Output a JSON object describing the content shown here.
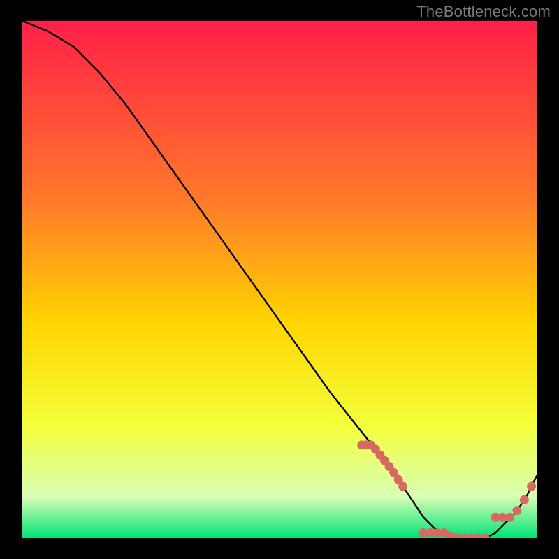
{
  "watermark": "TheBottleneck.com",
  "colors": {
    "gradient_top": "#ff1f48",
    "gradient_mid1": "#ff7a2a",
    "gradient_mid2": "#ffd400",
    "gradient_mid3": "#f4ff3a",
    "gradient_pale": "#d8ffb4",
    "gradient_green": "#00e27a",
    "curve": "#000000",
    "marker": "#d66a63",
    "background": "#000000"
  },
  "chart_data": {
    "type": "line",
    "title": "",
    "xlabel": "",
    "ylabel": "",
    "xlim": [
      0,
      100
    ],
    "ylim": [
      0,
      100
    ],
    "x": [
      0,
      5,
      10,
      15,
      20,
      25,
      30,
      35,
      40,
      45,
      50,
      55,
      60,
      64,
      68,
      72,
      74,
      76,
      78,
      80,
      82,
      84,
      86,
      88,
      90,
      92,
      94,
      96,
      98,
      100
    ],
    "values": [
      100,
      98,
      95,
      90,
      84,
      77,
      70,
      63,
      56,
      49,
      42,
      35,
      28,
      23,
      18,
      13,
      10,
      7,
      4,
      2,
      1,
      0,
      0,
      0,
      0,
      1,
      3,
      5,
      8,
      12
    ],
    "markers": {
      "cluster_left": {
        "x_range": [
          66,
          74
        ],
        "y_range": [
          10,
          18
        ],
        "count": 10
      },
      "cluster_bottom": {
        "x_range": [
          78,
          90
        ],
        "y_range": [
          0,
          1
        ],
        "count": 10
      },
      "cluster_right": {
        "x_range": [
          92,
          99
        ],
        "y_range": [
          4,
          12
        ],
        "count": 6
      }
    },
    "gradient_stops": [
      {
        "offset": 0.0,
        "key": "gradient_top"
      },
      {
        "offset": 0.35,
        "key": "gradient_mid1"
      },
      {
        "offset": 0.58,
        "key": "gradient_mid2"
      },
      {
        "offset": 0.78,
        "key": "gradient_mid3"
      },
      {
        "offset": 0.92,
        "key": "gradient_pale"
      },
      {
        "offset": 1.0,
        "key": "gradient_green"
      }
    ]
  }
}
